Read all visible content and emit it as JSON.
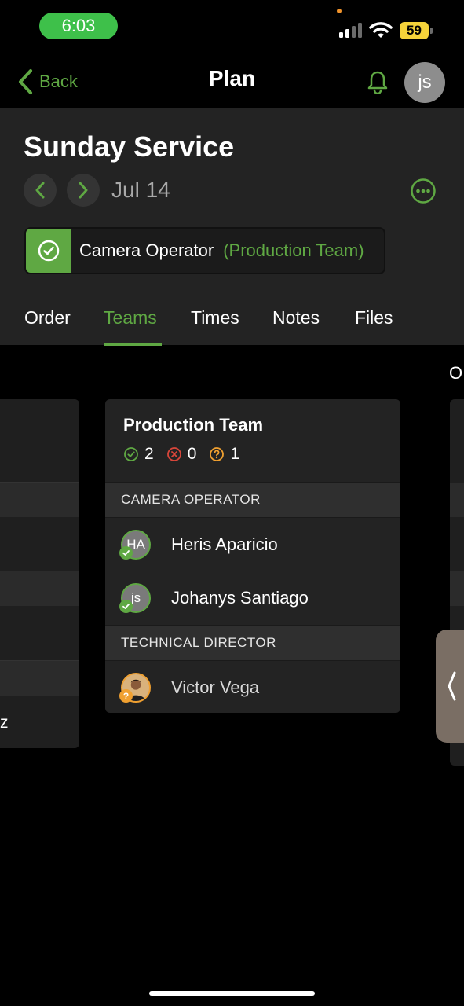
{
  "status_bar": {
    "time": "6:03",
    "battery": "59"
  },
  "nav": {
    "back_label": "Back",
    "title": "Plan",
    "avatar_initials": "js"
  },
  "plan": {
    "title": "Sunday Service",
    "date": "Jul 14"
  },
  "role": {
    "position": "Camera Operator",
    "team": "(Production Team)"
  },
  "tabs": [
    {
      "label": "Order"
    },
    {
      "label": "Teams"
    },
    {
      "label": "Times"
    },
    {
      "label": "Notes"
    },
    {
      "label": "Files"
    }
  ],
  "active_tab": "Teams",
  "offscreen": {
    "right_letter": "O",
    "left_fragment": "z"
  },
  "team_card": {
    "name": "Production Team",
    "counts": {
      "confirmed": "2",
      "declined": "0",
      "pending": "1"
    },
    "sections": [
      {
        "title": "CAMERA OPERATOR",
        "members": [
          {
            "initials": "HA",
            "name": "Heris Aparicio",
            "status": "confirmed"
          },
          {
            "initials": "js",
            "name": "Johanys Santiago",
            "status": "confirmed"
          }
        ]
      },
      {
        "title": "TECHNICAL DIRECTOR",
        "members": [
          {
            "initials": "",
            "name": "Victor Vega",
            "status": "pending"
          }
        ]
      }
    ]
  },
  "colors": {
    "accent": "#5fa843",
    "declined": "#d9463a",
    "pending": "#f0a030",
    "status_pill": "#3ec04a",
    "battery": "#f5d33a"
  }
}
